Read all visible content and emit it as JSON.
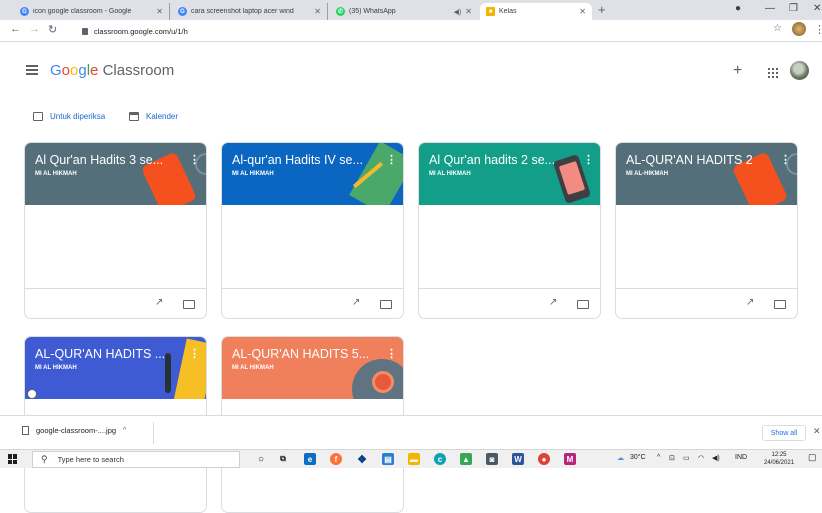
{
  "browser": {
    "tabs": [
      {
        "title": "icon google classroom - Google",
        "favicon": "G"
      },
      {
        "title": "cara screenshot laptop acer wind",
        "favicon": "G"
      },
      {
        "title": "(35) WhatsApp",
        "favicon": "whatsapp-icon"
      },
      {
        "title": "Kelas",
        "favicon": "classroom-icon"
      }
    ],
    "new_tab": "+",
    "url": "classroom.google.com/u/1/h"
  },
  "header": {
    "brand_google": "Google",
    "brand_product": "Classroom",
    "add": "+"
  },
  "shortcuts": [
    {
      "label": "Untuk diperiksa",
      "icon": "todo-icon"
    },
    {
      "label": "Kalender",
      "icon": "calendar-icon"
    }
  ],
  "classes": [
    {
      "title": "Al Qur'an Hadits 3 se...",
      "section": "MI AL HIKMAH",
      "color": "#546e7a"
    },
    {
      "title": "Al-qur'an Hadits IV se...",
      "section": "MI AL HIKMAH",
      "color": "#0b66c1"
    },
    {
      "title": "Al Qur'an hadits 2 se...",
      "section": "MI AL HIKMAH",
      "color": "#129e89"
    },
    {
      "title": "AL-QUR'AN HADITS 2",
      "section": "MI AL-HIKMAH",
      "color": "#546e7a"
    },
    {
      "title": "AL-QUR'AN HADITS ...",
      "section": "MI AL HIKMAH",
      "color": "#3f5bd4"
    },
    {
      "title": "AL-QUR'AN HADITS 5...",
      "section": "MI AL HIKMAH",
      "color": "#f07f5b"
    }
  ],
  "downloads": {
    "file": "google-classroom-....jpg",
    "show_all": "Show all"
  },
  "taskbar": {
    "search_placeholder": "Type here to search",
    "weather": "30°C",
    "language": "IND",
    "time": "12:25",
    "date": "24/06/2021"
  }
}
